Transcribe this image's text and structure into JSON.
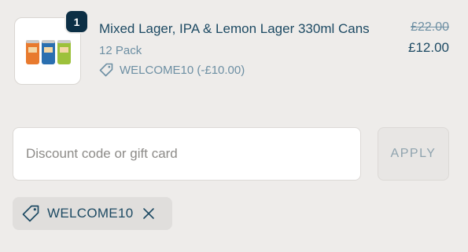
{
  "line_item": {
    "quantity": "1",
    "name": "Mixed Lager, IPA & Lemon Lager 330ml Cans",
    "variant": "12 Pack",
    "discount_code_label": "WELCOME10 (-£10.00)",
    "original_price": "£22.00",
    "price": "£12.00",
    "image_icon": "beer-cans-image"
  },
  "discount_form": {
    "input_value": "",
    "placeholder": "Discount code or gift card",
    "apply_label": "APPLY"
  },
  "applied_discount": {
    "code": "WELCOME10",
    "tag_icon": "tag-icon",
    "remove_icon": "close-icon"
  },
  "colors": {
    "background": "#eeecea",
    "text_primary": "#1d4a63",
    "text_muted": "#6d8fa3",
    "badge": "#0c2f45",
    "can_orange": "#e87a2e",
    "can_blue": "#2a6fb0",
    "can_green": "#9dc13b"
  }
}
